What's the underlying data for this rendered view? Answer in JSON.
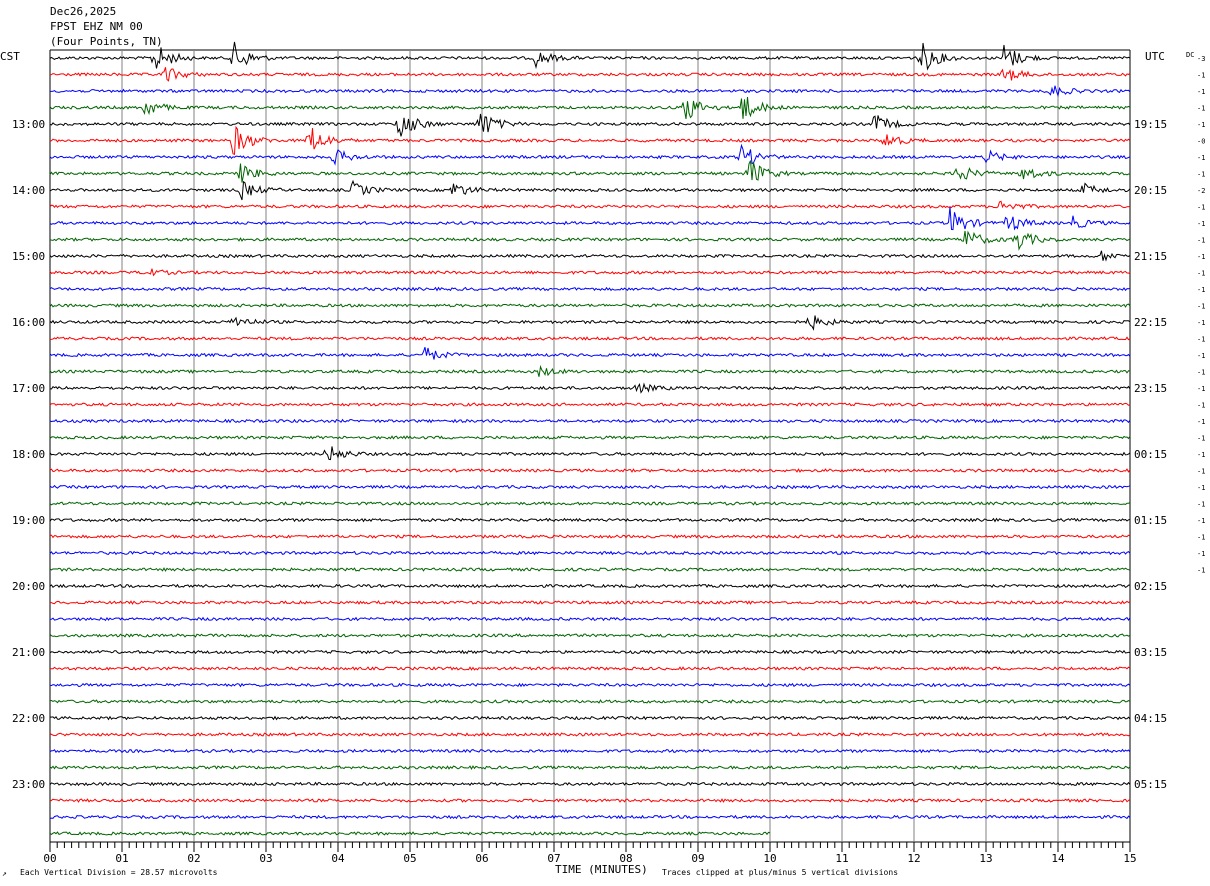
{
  "header": {
    "date": "Dec26,2025",
    "station": "FPST EHZ NM 00",
    "location": "(Four Points, TN)"
  },
  "chart_data": {
    "type": "line",
    "subtype": "seismic helicorder",
    "left_tz": "CST",
    "right_tz": "UTC",
    "dc_label": "DC",
    "xlabel": "TIME (MINUTES)",
    "x_ticks": [
      "00",
      "01",
      "02",
      "03",
      "04",
      "05",
      "06",
      "07",
      "08",
      "09",
      "10",
      "11",
      "12",
      "13",
      "14",
      "15"
    ],
    "xlim": [
      0,
      15
    ],
    "left_hour_labels": [
      "13:00",
      "14:00",
      "15:00",
      "16:00",
      "17:00",
      "18:00",
      "19:00",
      "20:00",
      "21:00",
      "22:00",
      "23:00"
    ],
    "right_hour_labels": [
      "19:15",
      "20:15",
      "21:15",
      "22:15",
      "23:15",
      "00:15",
      "01:15",
      "02:15",
      "03:15",
      "04:15",
      "05:15"
    ],
    "rows_per_hour": 4,
    "total_rows": 48,
    "first_row_start": "12:15",
    "trace_colors": [
      "#000000",
      "#ff0000",
      "#0000ff",
      "#006400"
    ],
    "last_trace_end_minute": 10.0,
    "dc_offsets": [
      "-3",
      "-1",
      "-1",
      "-1",
      "-1",
      "-0",
      "-1",
      "-1",
      "-2",
      "-1",
      "-1",
      "-1",
      "-1",
      "-1",
      "-1",
      "-1",
      "-1",
      "-1",
      "-1",
      "-1",
      "-1",
      "-1",
      "-1",
      "-1",
      "-1",
      "-1",
      "-1",
      "-1",
      "-1",
      "-1",
      "-1",
      "-1"
    ],
    "events": [
      {
        "row": 0,
        "minute": 1.45,
        "amp": 1.0
      },
      {
        "row": 0,
        "minute": 2.55,
        "amp": 1.0
      },
      {
        "row": 0,
        "minute": 6.75,
        "amp": 0.5
      },
      {
        "row": 0,
        "minute": 12.1,
        "amp": 1.0
      },
      {
        "row": 0,
        "minute": 13.25,
        "amp": 0.9
      },
      {
        "row": 1,
        "minute": 1.6,
        "amp": 0.5
      },
      {
        "row": 1,
        "minute": 13.25,
        "amp": 0.5
      },
      {
        "row": 2,
        "minute": 13.9,
        "amp": 0.4
      },
      {
        "row": 3,
        "minute": 1.3,
        "amp": 0.6
      },
      {
        "row": 3,
        "minute": 8.8,
        "amp": 1.0
      },
      {
        "row": 3,
        "minute": 9.6,
        "amp": 1.0
      },
      {
        "row": 4,
        "minute": 4.85,
        "amp": 1.0
      },
      {
        "row": 4,
        "minute": 5.95,
        "amp": 1.0
      },
      {
        "row": 4,
        "minute": 11.45,
        "amp": 0.6
      },
      {
        "row": 5,
        "minute": 2.55,
        "amp": 1.0
      },
      {
        "row": 5,
        "minute": 3.6,
        "amp": 1.0
      },
      {
        "row": 5,
        "minute": 11.6,
        "amp": 0.5
      },
      {
        "row": 6,
        "minute": 3.95,
        "amp": 0.5
      },
      {
        "row": 6,
        "minute": 9.6,
        "amp": 0.8
      },
      {
        "row": 6,
        "minute": 13.0,
        "amp": 0.4
      },
      {
        "row": 7,
        "minute": 2.65,
        "amp": 0.6
      },
      {
        "row": 7,
        "minute": 9.7,
        "amp": 1.0
      },
      {
        "row": 7,
        "minute": 12.6,
        "amp": 0.6
      },
      {
        "row": 7,
        "minute": 13.5,
        "amp": 0.5
      },
      {
        "row": 8,
        "minute": 2.65,
        "amp": 0.6
      },
      {
        "row": 8,
        "minute": 4.2,
        "amp": 0.5
      },
      {
        "row": 8,
        "minute": 5.6,
        "amp": 0.5
      },
      {
        "row": 8,
        "minute": 14.35,
        "amp": 0.4
      },
      {
        "row": 9,
        "minute": 13.2,
        "amp": 0.4
      },
      {
        "row": 10,
        "minute": 12.5,
        "amp": 1.0
      },
      {
        "row": 10,
        "minute": 13.3,
        "amp": 0.6
      },
      {
        "row": 10,
        "minute": 14.2,
        "amp": 0.4
      },
      {
        "row": 11,
        "minute": 12.7,
        "amp": 0.7
      },
      {
        "row": 11,
        "minute": 13.4,
        "amp": 0.8
      },
      {
        "row": 12,
        "minute": 14.6,
        "amp": 0.3
      },
      {
        "row": 13,
        "minute": 1.3,
        "amp": 0.3
      },
      {
        "row": 16,
        "minute": 2.55,
        "amp": 0.4
      },
      {
        "row": 16,
        "minute": 10.55,
        "amp": 0.5
      },
      {
        "row": 18,
        "minute": 5.2,
        "amp": 0.5
      },
      {
        "row": 19,
        "minute": 6.8,
        "amp": 0.3
      },
      {
        "row": 20,
        "minute": 8.15,
        "amp": 0.3
      },
      {
        "row": 24,
        "minute": 3.85,
        "amp": 0.6
      }
    ]
  },
  "footer": {
    "vertical_division": "Each Vertical Division =    28.57 microvolts",
    "clip_note": "Traces clipped at plus/minus 5 vertical divisions",
    "corner_mark": "↗"
  }
}
